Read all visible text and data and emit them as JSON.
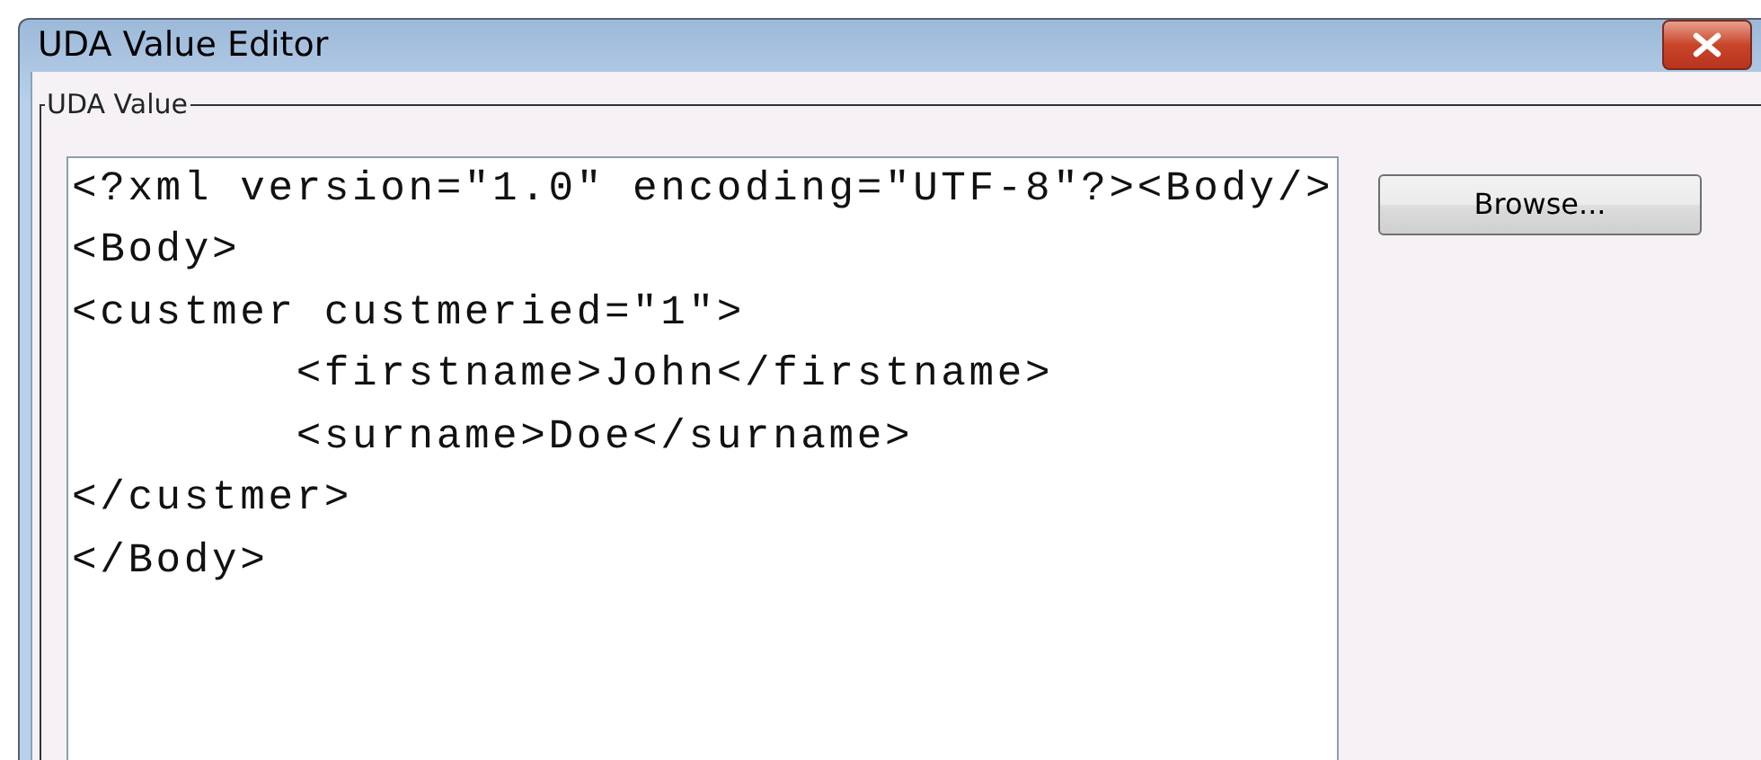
{
  "window": {
    "title": "UDA Value Editor"
  },
  "group": {
    "label": "UDA Value",
    "editor": {
      "lines": [
        "<?xml version=\"1.0\" encoding=\"UTF-8\"?><Body/>",
        "<Body>",
        "<custmer custmeried=\"1\">",
        "\t<firstname>John</firstname>",
        "\t<surname>Doe</surname>",
        "</custmer>",
        "</Body>"
      ]
    },
    "buttons": [
      "Browse..."
    ]
  }
}
